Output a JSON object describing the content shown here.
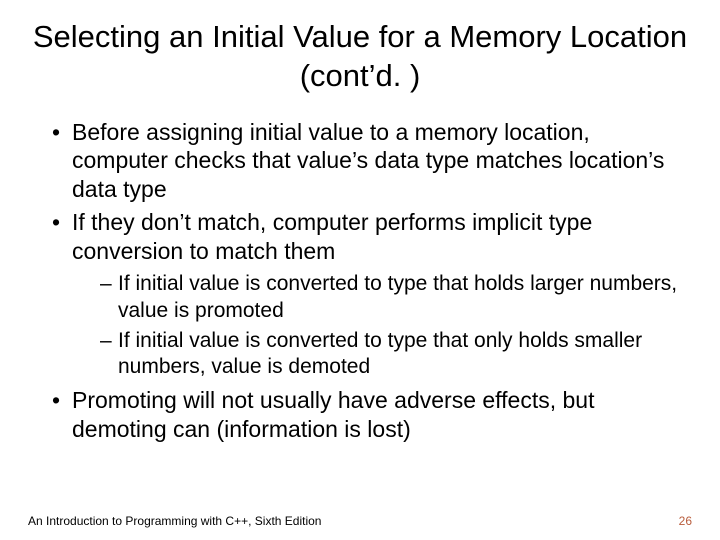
{
  "title": "Selecting an Initial Value for a Memory Location (cont’d. )",
  "bullets": [
    "Before assigning initial value to a memory location, computer checks that value’s data type matches location’s data type",
    "If they don’t match, computer performs implicit type conversion to match them",
    "Promoting will not usually have adverse effects, but demoting can (information is lost)"
  ],
  "subbullets": [
    "If initial value is converted to type that holds larger numbers, value is promoted",
    "If initial value is converted to type that only holds smaller numbers, value is demoted"
  ],
  "footer": {
    "left": "An Introduction to Programming with C++, Sixth Edition",
    "page": "26"
  }
}
